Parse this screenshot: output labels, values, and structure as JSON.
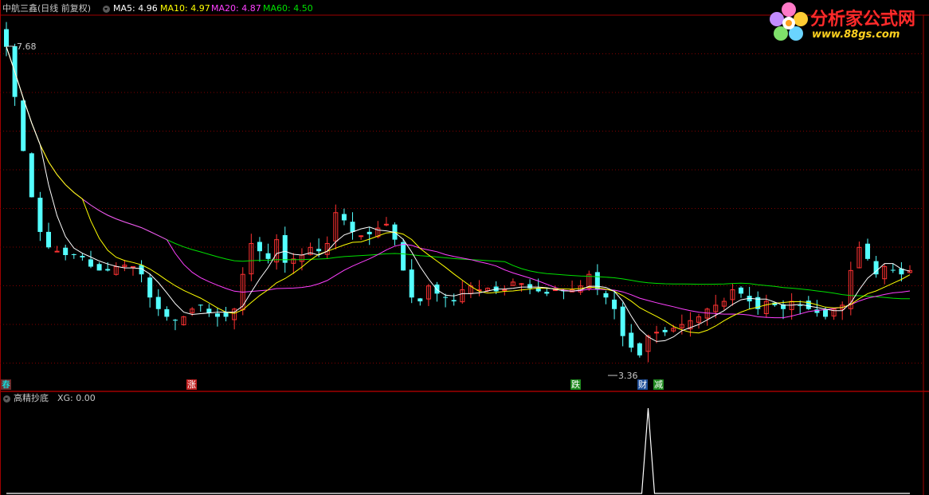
{
  "main_panel": {
    "stock_title": "中航三鑫(日线 前复权)",
    "ma_labels": [
      {
        "text": "MA5: 4.96",
        "color": "#ffffff"
      },
      {
        "text": "MA10: 4.97",
        "color": "#ffff00"
      },
      {
        "text": "MA20: 4.87",
        "color": "#ff40ff"
      },
      {
        "text": "MA60: 4.50",
        "color": "#00e000"
      }
    ],
    "high_label": "7.68",
    "low_label": "3.36",
    "event_markers": [
      {
        "text": "春",
        "color": "#00ffff",
        "bg": "#6e2a2a"
      },
      {
        "text": "涨",
        "color": "#ffffff",
        "bg": "#c02020"
      },
      {
        "text": "跌",
        "color": "#ffffff",
        "bg": "#1f8a1f"
      },
      {
        "text": "财",
        "color": "#ffffff",
        "bg": "#1f4f9a"
      },
      {
        "text": "减",
        "color": "#ffffff",
        "bg": "#1f8a1f"
      }
    ]
  },
  "sub_panel": {
    "indicator_title": "高精抄底",
    "indicator_value": "XG: 0.00"
  },
  "logo": {
    "title": "分析家公式网",
    "url": "www.88gs.com"
  },
  "colors": {
    "up_candle": "#ff3232",
    "down_candle": "#54ffff",
    "grid": "#800000",
    "frame": "#a00000",
    "ma5": "#ffffff",
    "ma10": "#ffff00",
    "ma20": "#ff40ff",
    "ma60": "#00e000",
    "indicator": "#ffffff"
  },
  "chart_data": {
    "type": "candlestick",
    "price_range": [
      3.36,
      7.68
    ],
    "close": [
      7.45,
      6.8,
      6.1,
      5.5,
      5.05,
      4.85,
      4.8,
      4.75,
      4.75,
      4.72,
      4.6,
      4.55,
      4.55,
      4.6,
      4.62,
      4.6,
      4.5,
      4.2,
      4.05,
      3.95,
      3.9,
      3.95,
      4.05,
      4.1,
      4.0,
      3.95,
      3.95,
      4.05,
      4.5,
      4.9,
      4.8,
      4.7,
      4.95,
      4.65,
      4.7,
      4.75,
      4.85,
      4.8,
      4.9,
      5.3,
      5.2,
      5.05,
      5.0,
      5.02,
      5.1,
      5.15,
      4.95,
      4.55,
      4.2,
      4.15,
      4.35,
      4.25,
      4.2,
      4.15,
      4.3,
      4.35,
      4.3,
      4.32,
      4.28,
      4.3,
      4.4,
      4.38,
      4.32,
      4.28,
      4.25,
      4.3,
      4.28,
      4.3,
      4.35,
      4.5,
      4.3,
      4.2,
      4.05,
      3.7,
      3.55,
      3.45,
      3.7,
      3.75,
      3.75,
      3.8,
      3.85,
      3.9,
      3.95,
      4.05,
      4.1,
      4.15,
      4.3,
      4.25,
      4.15,
      4.05,
      4.15,
      4.1,
      4.05,
      4.15,
      4.1,
      4.05,
      4.0,
      3.95,
      4.05,
      4.1,
      4.55,
      4.85,
      4.7,
      4.5,
      4.6,
      4.55,
      4.5,
      4.55
    ],
    "ma5_last": 4.96,
    "ma10_last": 4.97,
    "ma20_last": 4.87,
    "ma60_last": 4.5,
    "indicator_signal_index": 76,
    "indicator_value": 0.0
  }
}
